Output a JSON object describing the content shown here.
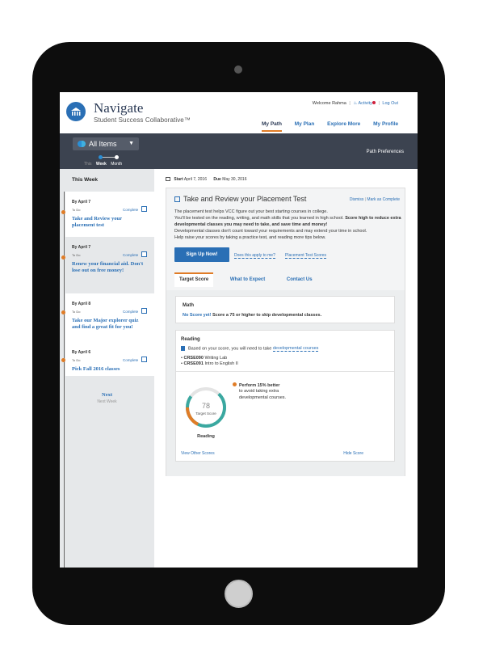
{
  "header": {
    "app_name": "Navigate",
    "app_subtitle": "Student Success Collaborative™",
    "welcome": "Welcome Rahma",
    "activity": "Activity",
    "logout": "Log Out",
    "nav": [
      {
        "label": "My Path",
        "active": true
      },
      {
        "label": "My Plan",
        "active": false
      },
      {
        "label": "Explore More",
        "active": false
      },
      {
        "label": "My Profile",
        "active": false
      }
    ]
  },
  "toolbar": {
    "filter_label": "All Items",
    "range_labels": [
      "This",
      "Week",
      "Month"
    ],
    "selected_range": "Week",
    "path_preferences": "Path Preferences"
  },
  "sidebar": {
    "heading": "This Week",
    "items": [
      {
        "due": "By April 7",
        "status": "To Do",
        "complete": "Complete",
        "title": "Take and Review your placement test"
      },
      {
        "due": "By April 7",
        "status": "To Do",
        "complete": "Complete",
        "title": "Renew your financial aid. Don't lose out on free money!"
      },
      {
        "due": "By April 8",
        "status": "To Do",
        "complete": "Complete",
        "title": "Take our Major explorer quiz and find a great fit for you!"
      },
      {
        "due": "By April 6",
        "status": "To Do",
        "complete": "Complete",
        "title": "Pick Fall 2016 classes"
      }
    ],
    "next_label": "Next",
    "next_sub": "Next Week"
  },
  "task": {
    "start_label": "Start",
    "start_date": "April 7, 2016",
    "due_label": "Due",
    "due_date": "May 30, 2016",
    "title": "Take and Review your Placement Test",
    "dismiss": "Dismiss",
    "mark_complete": "Mark as Complete",
    "desc_line1": "The placement test helps VCC figure out your best starting courses in college.",
    "desc_line2": "You'll be tested on the reading, writing, and math skills that you learned in high school.",
    "desc_bold": "Score high to reduce extra developmental classes you may need to take, and save time and money!",
    "desc_line3": "Developmental classes don't count toward your requirements and may extend your time in school.",
    "desc_line4": "Help raise your scores by taking a practice test, and reading more tips below.",
    "signup_button": "Sign Up Now!",
    "link_apply": "Does this apply to me?",
    "link_scores": "Placement Test Scores",
    "tabs": [
      "Target Score",
      "What to Expect",
      "Contact Us"
    ],
    "active_tab": "Target Score"
  },
  "math": {
    "title": "Math",
    "no_score": "No Score yet!",
    "message": "Score a 75 or higher to skip developmental classes."
  },
  "reading": {
    "title": "Reading",
    "based_text": "Based on your score, you will need to take",
    "based_link": "developmental courses",
    "courses": [
      {
        "code": "CRSE090",
        "name": "Writing Lab"
      },
      {
        "code": "CRSE091",
        "name": "Intro to English II"
      }
    ],
    "target_value": "78",
    "target_label": "Target Score",
    "gauge_label": "Reading",
    "progress_fraction": 0.85,
    "perform_bold": "Perform 15% better",
    "perform_text1": "to avoid taking extra",
    "perform_text2": "developmental courses.",
    "view_other": "View Other Scores",
    "hide_score": "Hide Score"
  },
  "colors": {
    "brand_blue": "#2a6fb5",
    "accent_orange": "#e07c26",
    "toolbar_dark": "#3c4350",
    "gauge_teal": "#3aa8a0"
  }
}
